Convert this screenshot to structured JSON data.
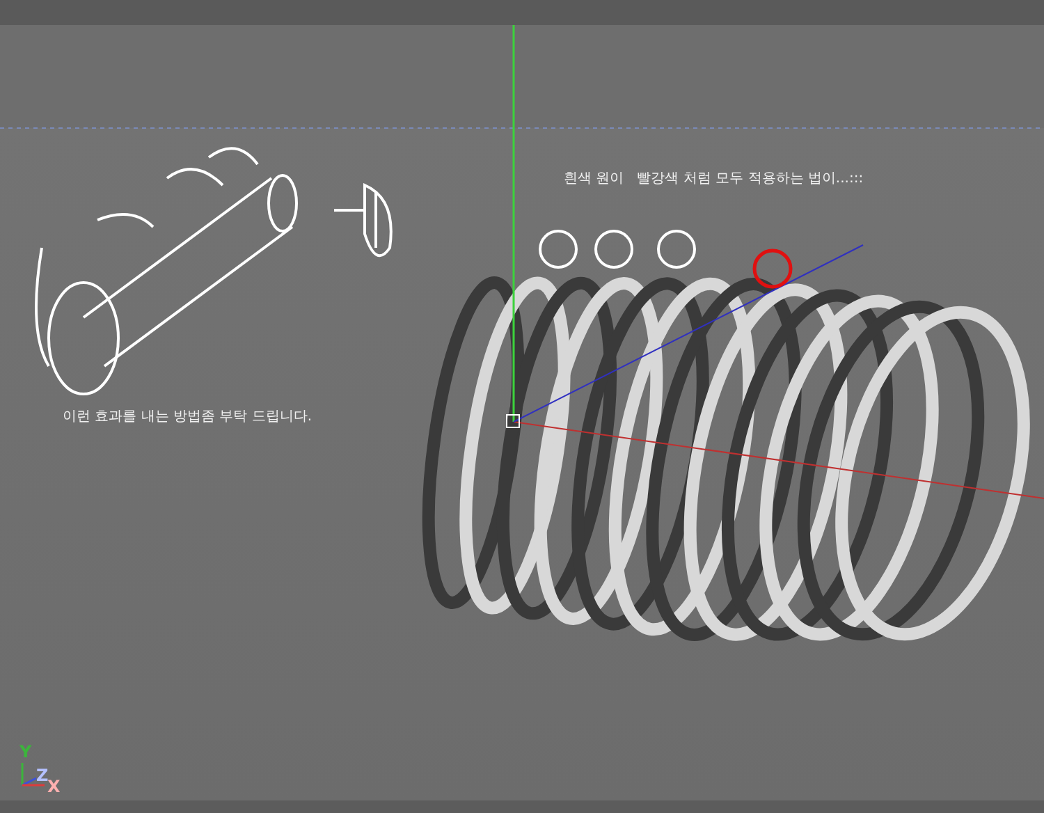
{
  "viewport": {
    "annotations": [
      {
        "text": "흰색 원이   빨강색 처럼 모두 적용하는 법이...:::"
      },
      {
        "text": "이런 효과를 내는 방법좀 부탁 드립니다."
      }
    ],
    "axis_labels": [
      {
        "text": "Y",
        "color": "#3cb43c"
      },
      {
        "text": "Z",
        "color": "#b4c0ff"
      },
      {
        "text": "X",
        "color": "#ffb0b0"
      }
    ]
  }
}
